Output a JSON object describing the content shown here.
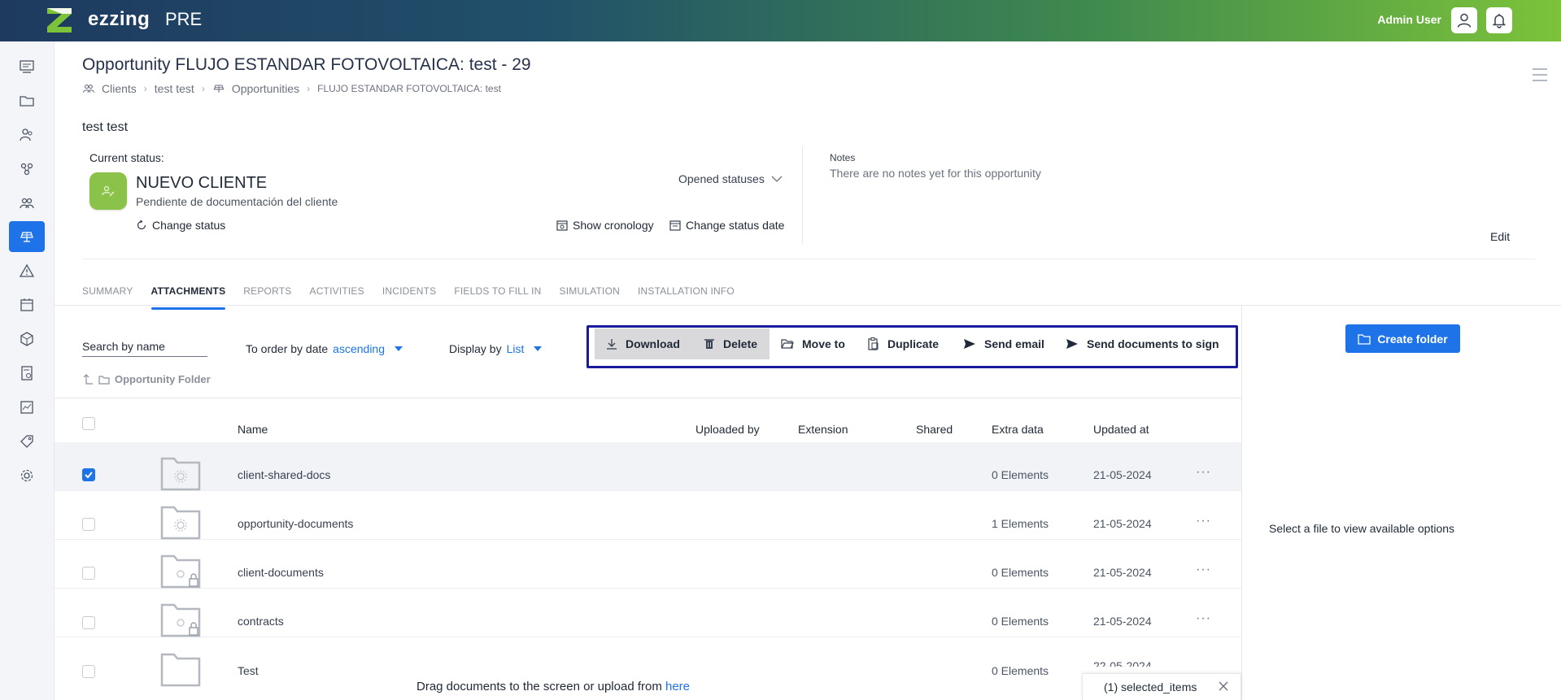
{
  "app": {
    "brand": "ezzing",
    "env": "PRE",
    "user": "Admin User"
  },
  "icons": {
    "user": "user-icon",
    "bell": "bell-icon",
    "menu": "hamburger-menu-icon"
  },
  "colors": {
    "accent": "#1e73e8",
    "status_green": "#8bc34a",
    "highlight_border": "#1a1a9c"
  },
  "page": {
    "title": "Opportunity FLUJO ESTANDAR FOTOVOLTAICA: test - 29",
    "breadcrumb": [
      "Clients",
      "test test",
      "Opportunities",
      "FLUJO ESTANDAR FOTOVOLTAICA: test"
    ],
    "client_name": "test test"
  },
  "status": {
    "label": "Current status:",
    "name": "NUEVO CLIENTE",
    "description": "Pendiente de documentación del cliente",
    "change_status": "Change status",
    "opened_statuses": "Opened statuses",
    "show_cronology": "Show cronology",
    "change_status_date": "Change status date"
  },
  "notes": {
    "label": "Notes",
    "text": "There are no notes yet for this opportunity",
    "edit": "Edit"
  },
  "tabs": [
    "SUMMARY",
    "ATTACHMENTS",
    "REPORTS",
    "ACTIVITIES",
    "INCIDENTS",
    "FIELDS TO FILL IN",
    "SIMULATION",
    "INSTALLATION INFO"
  ],
  "active_tab": "ATTACHMENTS",
  "toolbar": {
    "search_placeholder": "Search by name",
    "order_label": "To order by date",
    "order_value": "ascending",
    "display_label": "Display by",
    "display_value": "List",
    "actions": [
      "Download",
      "Delete",
      "Move to",
      "Duplicate",
      "Send email",
      "Send documents to sign"
    ],
    "create_folder": "Create folder"
  },
  "folder_path": "Opportunity Folder",
  "table": {
    "columns": [
      "Name",
      "Uploaded by",
      "Extension",
      "Shared",
      "Extra data",
      "Updated at"
    ],
    "rows": [
      {
        "name": "client-shared-docs",
        "extra": "0 Elements",
        "updated": "21-05-2024",
        "checked": true
      },
      {
        "name": "opportunity-documents",
        "extra": "1 Elements",
        "updated": "21-05-2024",
        "checked": false
      },
      {
        "name": "client-documents",
        "extra": "0 Elements",
        "updated": "21-05-2024",
        "checked": false
      },
      {
        "name": "contracts",
        "extra": "0 Elements",
        "updated": "21-05-2024",
        "checked": false
      },
      {
        "name": "Test",
        "extra": "0 Elements",
        "updated": "22-05-2024",
        "checked": false
      }
    ]
  },
  "panel": {
    "hint": "Select a file to view available options"
  },
  "footer": {
    "drag_text": "Drag documents to the screen or upload from",
    "drag_link": "here",
    "selected": "(1) selected_items"
  }
}
